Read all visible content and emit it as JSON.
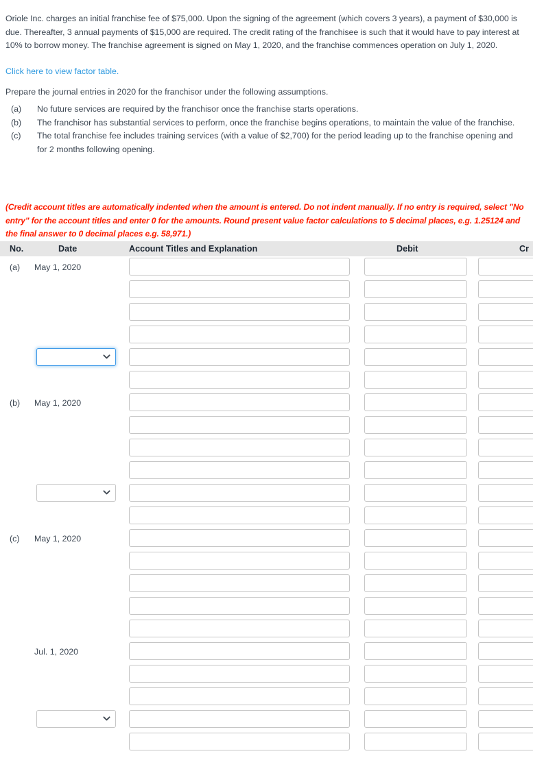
{
  "problem": {
    "intro": "Oriole Inc. charges an initial franchise fee of $75,000. Upon the signing of the agreement (which covers 3 years), a payment of $30,000 is due. Thereafter, 3 annual payments of $15,000 are required. The credit rating of the franchisee is such that it would have to pay interest at 10% to borrow money. The franchise agreement is signed on May 1, 2020, and the franchise commences operation on July 1, 2020.",
    "factor_table_link": "Click here to view factor table.",
    "prepare_line": "Prepare the journal entries in 2020 for the franchisor under the following assumptions.",
    "assumptions": [
      {
        "label": "(a)",
        "text": "No future services are required by the franchisor once the franchise starts operations."
      },
      {
        "label": "(b)",
        "text": "The franchisor has substantial services to perform, once the franchise begins operations, to maintain the value of the franchise."
      },
      {
        "label": "(c)",
        "text": "The total franchise fee includes training services (with a value of $2,700) for the period leading up to the franchise opening and for 2 months following opening."
      }
    ],
    "instruction_note": "(Credit account titles are automatically indented when the amount is entered. Do not indent manually. If no entry is required, select \"No entry\" for the account titles and enter 0 for the amounts. Round present value factor calculations to 5 decimal places, e.g. 1.25124 and the final answer to 0 decimal places e.g. 58,971.)"
  },
  "colors": {
    "link": "#2f9ae0",
    "note_red": "#fe1e00",
    "header_bg": "#e6e6e6",
    "text": "#3d4753",
    "focus_blue": "#3f9ae8",
    "input_border": "#c6c6c6"
  },
  "journal": {
    "headers": {
      "no": "No.",
      "date": "Date",
      "account": "Account Titles and Explanation",
      "debit": "Debit",
      "credit": "Cr"
    },
    "select_placeholder": "",
    "rows": [
      {
        "no": "(a)",
        "date": "May 1, 2020",
        "type": "input",
        "account": "",
        "debit": "",
        "credit": ""
      },
      {
        "no": "",
        "date": "",
        "type": "input",
        "account": "",
        "debit": "",
        "credit": ""
      },
      {
        "no": "",
        "date": "",
        "type": "input",
        "account": "",
        "debit": "",
        "credit": ""
      },
      {
        "no": "",
        "date": "",
        "type": "input",
        "account": "",
        "debit": "",
        "credit": ""
      },
      {
        "no": "",
        "date": "",
        "type": "select",
        "selected": "",
        "focused": true,
        "account": "",
        "debit": "",
        "credit": ""
      },
      {
        "no": "",
        "date": "",
        "type": "input",
        "account": "",
        "debit": "",
        "credit": ""
      },
      {
        "no": "(b)",
        "date": "May 1, 2020",
        "type": "input",
        "account": "",
        "debit": "",
        "credit": ""
      },
      {
        "no": "",
        "date": "",
        "type": "input",
        "account": "",
        "debit": "",
        "credit": ""
      },
      {
        "no": "",
        "date": "",
        "type": "input",
        "account": "",
        "debit": "",
        "credit": ""
      },
      {
        "no": "",
        "date": "",
        "type": "input",
        "account": "",
        "debit": "",
        "credit": ""
      },
      {
        "no": "",
        "date": "",
        "type": "select",
        "selected": "",
        "focused": false,
        "account": "",
        "debit": "",
        "credit": ""
      },
      {
        "no": "",
        "date": "",
        "type": "input",
        "account": "",
        "debit": "",
        "credit": ""
      },
      {
        "no": "(c)",
        "date": "May 1, 2020",
        "type": "input",
        "account": "",
        "debit": "",
        "credit": ""
      },
      {
        "no": "",
        "date": "",
        "type": "input",
        "account": "",
        "debit": "",
        "credit": ""
      },
      {
        "no": "",
        "date": "",
        "type": "input",
        "account": "",
        "debit": "",
        "credit": ""
      },
      {
        "no": "",
        "date": "",
        "type": "input",
        "account": "",
        "debit": "",
        "credit": ""
      },
      {
        "no": "",
        "date": "",
        "type": "input",
        "account": "",
        "debit": "",
        "credit": ""
      },
      {
        "no": "",
        "date": "Jul. 1, 2020",
        "type": "input",
        "account": "",
        "debit": "",
        "credit": ""
      },
      {
        "no": "",
        "date": "",
        "type": "input",
        "account": "",
        "debit": "",
        "credit": ""
      },
      {
        "no": "",
        "date": "",
        "type": "input",
        "account": "",
        "debit": "",
        "credit": ""
      },
      {
        "no": "",
        "date": "",
        "type": "select",
        "selected": "",
        "focused": false,
        "account": "",
        "debit": "",
        "credit": ""
      },
      {
        "no": "",
        "date": "",
        "type": "input",
        "account": "",
        "debit": "",
        "credit": ""
      }
    ]
  }
}
